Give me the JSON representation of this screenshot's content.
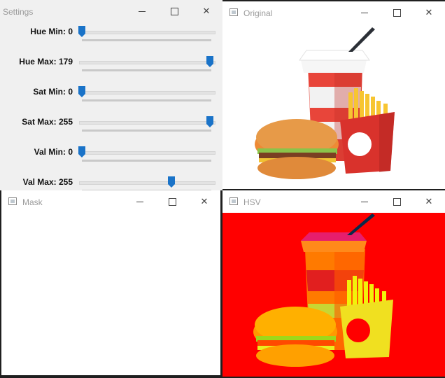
{
  "settings": {
    "title": "Settings",
    "trackbars": [
      {
        "label": "Hue Min: 0",
        "fraction": 0.0
      },
      {
        "label": "Hue Max: 179",
        "fraction": 1.0
      },
      {
        "label": "Sat Min: 0",
        "fraction": 0.0
      },
      {
        "label": "Sat Max: 255",
        "fraction": 1.0
      },
      {
        "label": "Val Min: 0",
        "fraction": 0.0
      },
      {
        "label": "Val Max: 255",
        "fraction": 0.7
      }
    ]
  },
  "windows": {
    "original": {
      "title": "Original"
    },
    "mask": {
      "title": "Mask"
    },
    "hsv": {
      "title": "HSV"
    }
  },
  "controls": {
    "minimize": "—",
    "maximize": "☐",
    "close": "✕"
  },
  "colors": {
    "thumb": "#1a73c8",
    "hsv_background": "#ff0000",
    "mask_background": "#ffffff"
  }
}
